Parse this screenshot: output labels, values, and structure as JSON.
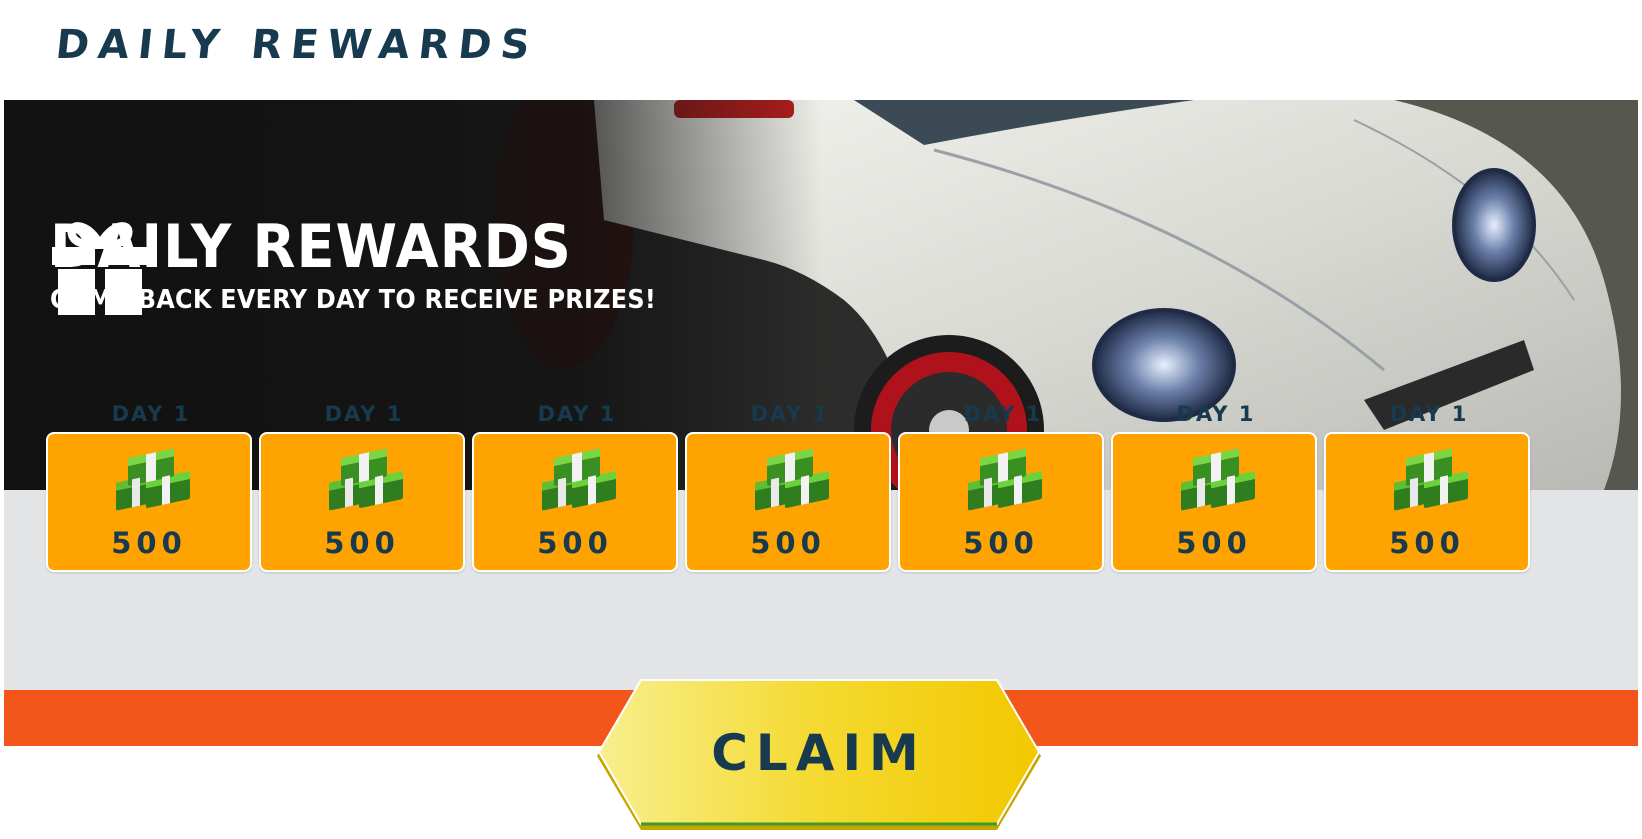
{
  "header": {
    "title": "DAILY REWARDS"
  },
  "banner": {
    "title": "DAILY REWARDS",
    "subtitle": "COME BACK EVERY DAY TO RECEIVE PRIZES!"
  },
  "rewards": [
    {
      "day_label": "DAY 1",
      "amount": "500",
      "icon": "cash-stack-icon"
    },
    {
      "day_label": "DAY 1",
      "amount": "500",
      "icon": "cash-stack-icon"
    },
    {
      "day_label": "DAY 1",
      "amount": "500",
      "icon": "cash-stack-icon"
    },
    {
      "day_label": "DAY 1",
      "amount": "500",
      "icon": "cash-stack-icon"
    },
    {
      "day_label": "DAY 1",
      "amount": "500",
      "icon": "cash-stack-icon"
    },
    {
      "day_label": "DAY 1",
      "amount": "500",
      "icon": "cash-stack-icon"
    },
    {
      "day_label": "DAY 1",
      "amount": "500",
      "icon": "cash-stack-icon"
    }
  ],
  "claim_button": {
    "label": "CLAIM"
  },
  "colors": {
    "title": "#173a4e",
    "card": "#ffa300",
    "bar": "#f2561a",
    "button": "#f5d21c"
  }
}
